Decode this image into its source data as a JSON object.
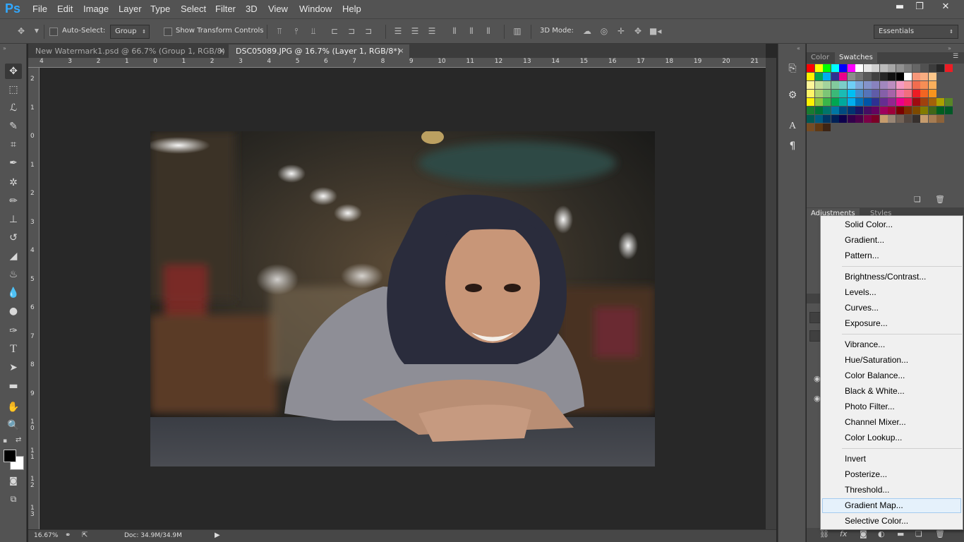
{
  "app": {
    "logo": "Ps"
  },
  "menu": [
    "File",
    "Edit",
    "Image",
    "Layer",
    "Type",
    "Select",
    "Filter",
    "3D",
    "View",
    "Window",
    "Help"
  ],
  "window_controls": {
    "minimize": "▬",
    "restore": "❐",
    "close": "✕"
  },
  "options": {
    "auto_select_label": "Auto-Select:",
    "auto_select_value": "Group",
    "show_transform_label": "Show Transform Controls",
    "mode_3d_label": "3D Mode:",
    "workspace": "Essentials"
  },
  "tabs": [
    {
      "label": "New Watermark1.psd @ 66.7% (Group 1, RGB/8)",
      "close": "×"
    },
    {
      "label": "DSC05089.JPG @ 16.7% (Layer 1, RGB/8*)",
      "close": "×"
    }
  ],
  "ruler_h": [
    "4",
    "3",
    "2",
    "1",
    "0",
    "1",
    "2",
    "3",
    "4",
    "5",
    "6",
    "7",
    "8",
    "9",
    "10",
    "11",
    "12",
    "13",
    "14",
    "15",
    "16",
    "17",
    "18",
    "19",
    "20",
    "21"
  ],
  "ruler_v": [
    "2",
    "1",
    "0",
    "1",
    "2",
    "3",
    "4",
    "5",
    "6",
    "7",
    "8",
    "9",
    "1 0",
    "1 1",
    "1 2",
    "1 3"
  ],
  "status": {
    "zoom": "16.67%",
    "doc": "Doc: 34.9M/34.9M"
  },
  "panels": {
    "color_tab": "Color",
    "swatches_tab": "Swatches",
    "adjustments_tab": "Adjustments",
    "styles_tab": "Styles"
  },
  "swatch_rows": [
    [
      "#ff0000",
      "#ffff00",
      "#00ff00",
      "#00ffff",
      "#0000ff",
      "#ff00ff",
      "#ffffff",
      "#e6e6e6",
      "#d0d0d0",
      "#bbbbbb",
      "#a6a6a6",
      "#919191",
      "#7c7c7c",
      "#666666",
      "#515151",
      "#3c3c3c",
      "#262626",
      "#ed1c24"
    ],
    [
      "#fff200",
      "#00a651",
      "#00aeef",
      "#2e3192",
      "#ec008c",
      "#8c8c8c",
      "#737373",
      "#595959",
      "#404040",
      "#262626",
      "#111111",
      "#000000",
      "#ffffff",
      "#f7977a",
      "#f9ad81",
      "#fdc68a"
    ],
    [
      "#fff79a",
      "#c4df9b",
      "#a3d39c",
      "#82ca9d",
      "#7bcdc8",
      "#6ecff6",
      "#7ea7d8",
      "#8493ca",
      "#8882be",
      "#a187be",
      "#bc8dbf",
      "#f49ac2",
      "#f6989d",
      "#f26c4f",
      "#f68e55",
      "#fbaf5c"
    ],
    [
      "#fff568",
      "#acd372",
      "#7cc576",
      "#3bb878",
      "#1abbb4",
      "#00bff3",
      "#438ccb",
      "#5574b9",
      "#605ca8",
      "#855fa8",
      "#a763a8",
      "#f06ea9",
      "#f26d7d",
      "#ed1c24",
      "#f26522",
      "#f7941d"
    ],
    [
      "#fff200",
      "#8dc63f",
      "#39b54a",
      "#00a651",
      "#00a99d",
      "#00aeef",
      "#0072bc",
      "#0054a6",
      "#2e3192",
      "#662d91",
      "#92278f",
      "#ec008c",
      "#ed145b",
      "#9e0b0f",
      "#a0410d",
      "#a36209",
      "#aba000",
      "#598527"
    ],
    [
      "#197b30",
      "#007236",
      "#00746b",
      "#0076a3",
      "#004a80",
      "#003471",
      "#1b1464",
      "#440e62",
      "#630460",
      "#9e005d",
      "#9e0039",
      "#790000",
      "#7b2e00",
      "#7d4900",
      "#827b00",
      "#406618",
      "#005e20",
      "#005826"
    ],
    [
      "#005952",
      "#005b7f",
      "#003663",
      "#002157",
      "#0d004c",
      "#32004b",
      "#4b0049",
      "#7b0046",
      "#7a0026",
      "#c69c6d",
      "#998675",
      "#736357",
      "#534741",
      "#37302d",
      "#c69c6d",
      "#a67c52",
      "#8c6239"
    ],
    [
      "#754c24",
      "#603913",
      "#3c2415"
    ]
  ],
  "menu_items": [
    "Solid Color...",
    "Gradient...",
    "Pattern...",
    "Brightness/Contrast...",
    "Levels...",
    "Curves...",
    "Exposure...",
    "Vibrance...",
    "Hue/Saturation...",
    "Color Balance...",
    "Black & White...",
    "Photo Filter...",
    "Channel Mixer...",
    "Color Lookup...",
    "Invert",
    "Posterize...",
    "Threshold...",
    "Gradient Map...",
    "Selective Color..."
  ],
  "highlighted_item": "Gradient Map...",
  "colors": {
    "accent": "#31a8ff",
    "ui": "#535353",
    "canvas": "#282828",
    "highlight": "#e5f1fb"
  }
}
